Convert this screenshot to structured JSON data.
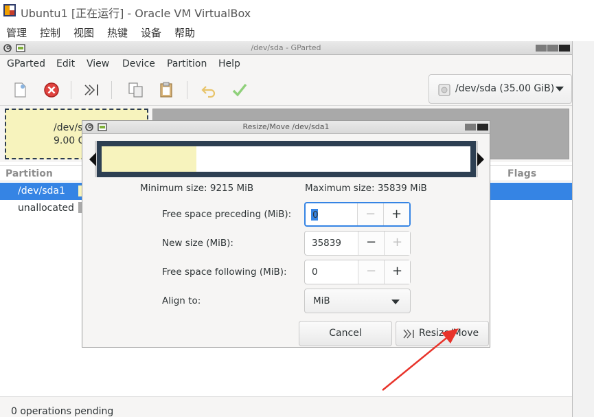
{
  "vbox": {
    "title": "Ubuntu1 [正在运行] - Oracle VM VirtualBox",
    "menu": [
      "管理",
      "控制",
      "视图",
      "热键",
      "设备",
      "帮助"
    ]
  },
  "gparted": {
    "window_title": "/dev/sda - GParted",
    "menu": [
      "GParted",
      "Edit",
      "View",
      "Device",
      "Partition",
      "Help"
    ],
    "toolbar_icons": [
      "new-icon",
      "delete-icon",
      "resize-move-icon",
      "copy-icon",
      "paste-icon",
      "undo-icon",
      "apply-icon"
    ],
    "device": "/dev/sda (35.00 GiB)",
    "disk_graphic": {
      "partition_label_1": "/dev/s",
      "partition_label_2": "9.00 G"
    },
    "columns": {
      "partition": "Partition",
      "flags": "Flags"
    },
    "rows": [
      {
        "name": "/dev/sda1",
        "selected": true,
        "color": "#f7f3bd"
      },
      {
        "name": "unallocated",
        "selected": false,
        "color": "#a9a9a9"
      }
    ],
    "status": "0 operations pending"
  },
  "dialog": {
    "title": "Resize/Move /dev/sda1",
    "min_size": "Minimum size: 9215 MiB",
    "max_size": "Maximum size: 35839 MiB",
    "used_fraction": 0.257,
    "fields": {
      "free_preceding": {
        "label": "Free space preceding (MiB):",
        "value": "0",
        "minus": "−",
        "plus": "+"
      },
      "new_size": {
        "label": "New size (MiB):",
        "value": "35839",
        "minus": "−",
        "plus": "+"
      },
      "free_following": {
        "label": "Free space following (MiB):",
        "value": "0",
        "minus": "−",
        "plus": "+"
      },
      "align": {
        "label": "Align to:",
        "value": "MiB"
      }
    },
    "cancel": "Cancel",
    "resize_move": "Resize/Move"
  },
  "colors": {
    "selection": "#3584e4",
    "used_space": "#f7f3bd",
    "unallocated": "#a9a9a9",
    "annotation_arrow": "#e8332a"
  }
}
